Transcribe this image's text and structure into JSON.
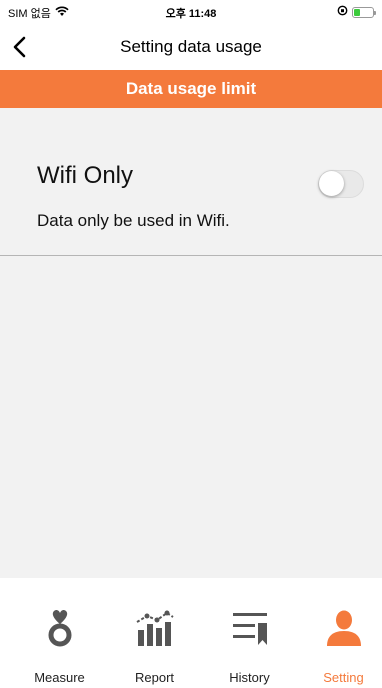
{
  "status_bar": {
    "carrier": "SIM 없음",
    "time": "오후 11:48"
  },
  "nav": {
    "title": "Setting data usage",
    "back_icon": "chevron-left-icon"
  },
  "section": {
    "header": "Data usage limit"
  },
  "wifi_only": {
    "title": "Wifi Only",
    "description": "Data only be used in Wifi.",
    "enabled": false
  },
  "tabs": [
    {
      "label": "Measure",
      "icon": "heart-ring-icon",
      "active": false
    },
    {
      "label": "Report",
      "icon": "bar-chart-icon",
      "active": false
    },
    {
      "label": "History",
      "icon": "list-bookmark-icon",
      "active": false
    },
    {
      "label": "Setting",
      "icon": "person-icon",
      "active": true
    }
  ],
  "colors": {
    "accent": "#f47a3c",
    "tab_icon": "#555555",
    "background": "#f2f2f2"
  }
}
